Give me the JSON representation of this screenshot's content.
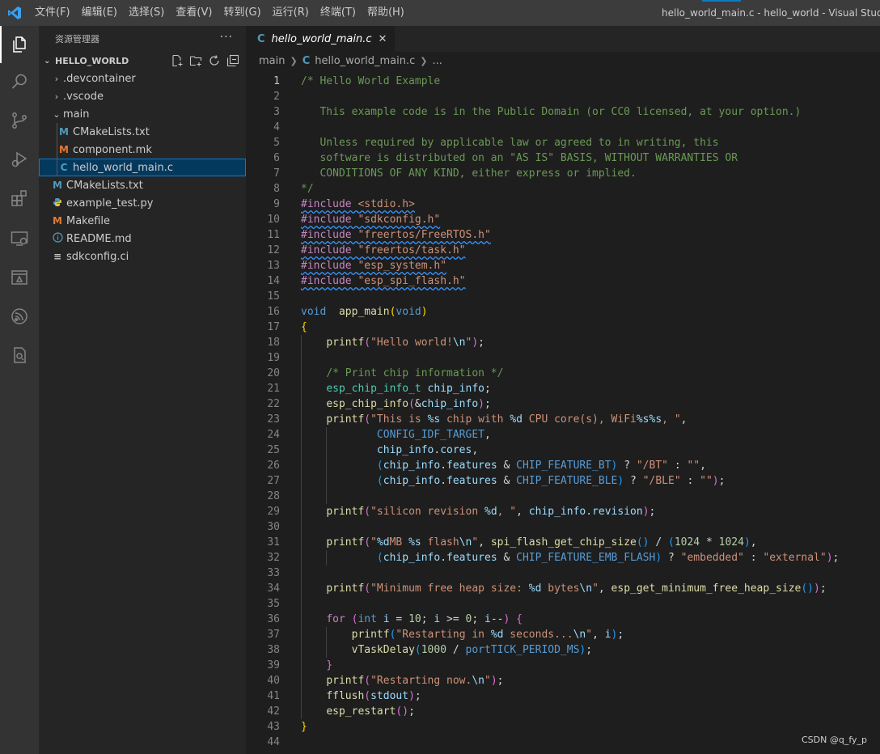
{
  "titlebar": {
    "menus": [
      "文件(F)",
      "编辑(E)",
      "选择(S)",
      "查看(V)",
      "转到(G)",
      "运行(R)",
      "终端(T)",
      "帮助(H)"
    ],
    "window_title": "hello_world_main.c - hello_world - Visual Studio Code",
    "accent_color": "#0e7ac4"
  },
  "activitybar": {
    "icons": [
      "explorer-icon",
      "search-icon",
      "source-control-icon",
      "run-debug-icon",
      "extensions-icon",
      "remote-explorer-icon",
      "deploy-icon",
      "espressif-icon",
      "test-icon"
    ]
  },
  "sidebar": {
    "title": "资源管理器",
    "more": "···",
    "section": "HELLO_WORLD",
    "tree": [
      {
        "label": ".devcontainer",
        "type": "folder",
        "expanded": false,
        "depth": 1
      },
      {
        "label": ".vscode",
        "type": "folder",
        "expanded": false,
        "depth": 1
      },
      {
        "label": "main",
        "type": "folder",
        "expanded": true,
        "depth": 1
      },
      {
        "label": "CMakeLists.txt",
        "type": "cmake",
        "depth": 2,
        "icon": "M"
      },
      {
        "label": "component.mk",
        "type": "make",
        "depth": 2,
        "icon": "M"
      },
      {
        "label": "hello_world_main.c",
        "type": "c",
        "depth": 2,
        "icon": "C",
        "selected": true
      },
      {
        "label": "CMakeLists.txt",
        "type": "cmake",
        "depth": 1,
        "icon": "M"
      },
      {
        "label": "example_test.py",
        "type": "python",
        "depth": 1,
        "icon": "py"
      },
      {
        "label": "Makefile",
        "type": "make",
        "depth": 1,
        "icon": "M"
      },
      {
        "label": "README.md",
        "type": "info",
        "depth": 1,
        "icon": "i"
      },
      {
        "label": "sdkconfig.ci",
        "type": "text",
        "depth": 1,
        "icon": "≡"
      }
    ]
  },
  "editor": {
    "tab_label": "hello_world_main.c",
    "tab_icon": "C",
    "close": "✕",
    "breadcrumb": {
      "folder": "main",
      "file": "hello_world_main.c",
      "more": "..."
    }
  },
  "code": {
    "current_line": 1,
    "lines": [
      [
        [
          "cmt",
          "/* Hello World Example"
        ]
      ],
      [],
      [
        [
          "cmt",
          "   This example code is in the Public Domain (or CC0 licensed, at your option.)"
        ]
      ],
      [],
      [
        [
          "cmt",
          "   Unless required by applicable law or agreed to in writing, this"
        ]
      ],
      [
        [
          "cmt",
          "   software is distributed on an \"AS IS\" BASIS, WITHOUT WARRANTIES OR"
        ]
      ],
      [
        [
          "cmt",
          "   CONDITIONS OF ANY KIND, either express or implied."
        ]
      ],
      [
        [
          "cmt",
          "*/"
        ]
      ],
      [
        [
          "pp squig",
          "#include "
        ],
        [
          "str squig",
          "<stdio.h>"
        ]
      ],
      [
        [
          "pp squig",
          "#include "
        ],
        [
          "str squig",
          "\"sdkconfig.h\""
        ]
      ],
      [
        [
          "pp squig",
          "#include "
        ],
        [
          "str squig",
          "\"freertos/FreeRTOS.h\""
        ]
      ],
      [
        [
          "pp squig",
          "#include "
        ],
        [
          "str squig",
          "\"freertos/task.h\""
        ]
      ],
      [
        [
          "pp squig",
          "#include "
        ],
        [
          "str squig",
          "\"esp_system.h\""
        ]
      ],
      [
        [
          "pp squig",
          "#include "
        ],
        [
          "str squig",
          "\"esp_spi_flash.h\""
        ]
      ],
      [],
      [
        [
          "kw",
          "void"
        ],
        [
          "",
          "  "
        ],
        [
          "fn",
          "app_main"
        ],
        [
          "brk",
          "("
        ],
        [
          "kw",
          "void"
        ],
        [
          "brk",
          ")"
        ]
      ],
      [
        [
          "brk",
          "{"
        ]
      ],
      [
        [
          "",
          "    "
        ],
        [
          "fn",
          "printf"
        ],
        [
          "brk2",
          "("
        ],
        [
          "str",
          "\"Hello world!"
        ],
        [
          "fmt",
          "\\n"
        ],
        [
          "str",
          "\""
        ],
        [
          "brk2",
          ")"
        ],
        [
          "",
          ";"
        ]
      ],
      [],
      [
        [
          "",
          "    "
        ],
        [
          "cmt",
          "/* Print chip information */"
        ]
      ],
      [
        [
          "",
          "    "
        ],
        [
          "typ",
          "esp_chip_info_t"
        ],
        [
          "",
          " "
        ],
        [
          "var",
          "chip_info"
        ],
        [
          "",
          ";"
        ]
      ],
      [
        [
          "",
          "    "
        ],
        [
          "fn",
          "esp_chip_info"
        ],
        [
          "brk2",
          "("
        ],
        [
          "",
          "&"
        ],
        [
          "var",
          "chip_info"
        ],
        [
          "brk2",
          ")"
        ],
        [
          "",
          ";"
        ]
      ],
      [
        [
          "",
          "    "
        ],
        [
          "fn",
          "printf"
        ],
        [
          "brk2",
          "("
        ],
        [
          "str",
          "\"This is "
        ],
        [
          "fmt",
          "%s"
        ],
        [
          "str",
          " chip with "
        ],
        [
          "fmt",
          "%d"
        ],
        [
          "str",
          " CPU core(s), WiFi"
        ],
        [
          "fmt",
          "%s%s"
        ],
        [
          "str",
          ", \""
        ],
        [
          "",
          ","
        ]
      ],
      [
        [
          "",
          "            "
        ],
        [
          "mac",
          "CONFIG_IDF_TARGET"
        ],
        [
          "",
          ","
        ]
      ],
      [
        [
          "",
          "            "
        ],
        [
          "var",
          "chip_info"
        ],
        [
          "",
          "."
        ],
        [
          "var",
          "cores"
        ],
        [
          "",
          ","
        ]
      ],
      [
        [
          "",
          "            "
        ],
        [
          "brk3",
          "("
        ],
        [
          "var",
          "chip_info"
        ],
        [
          "",
          "."
        ],
        [
          "var",
          "features"
        ],
        [
          "",
          " & "
        ],
        [
          "mac",
          "CHIP_FEATURE_BT"
        ],
        [
          "brk3",
          ")"
        ],
        [
          "",
          " ? "
        ],
        [
          "str",
          "\"/BT\""
        ],
        [
          "",
          " : "
        ],
        [
          "str",
          "\"\""
        ],
        [
          "",
          ","
        ]
      ],
      [
        [
          "",
          "            "
        ],
        [
          "brk3",
          "("
        ],
        [
          "var",
          "chip_info"
        ],
        [
          "",
          "."
        ],
        [
          "var",
          "features"
        ],
        [
          "",
          " & "
        ],
        [
          "mac",
          "CHIP_FEATURE_BLE"
        ],
        [
          "brk3",
          ")"
        ],
        [
          "",
          " ? "
        ],
        [
          "str",
          "\"/BLE\""
        ],
        [
          "",
          " : "
        ],
        [
          "str",
          "\"\""
        ],
        [
          "brk2",
          ")"
        ],
        [
          "",
          ";"
        ]
      ],
      [],
      [
        [
          "",
          "    "
        ],
        [
          "fn",
          "printf"
        ],
        [
          "brk2",
          "("
        ],
        [
          "str",
          "\"silicon revision "
        ],
        [
          "fmt",
          "%d"
        ],
        [
          "str",
          ", \""
        ],
        [
          "",
          ", "
        ],
        [
          "var",
          "chip_info"
        ],
        [
          "",
          "."
        ],
        [
          "var",
          "revision"
        ],
        [
          "brk2",
          ")"
        ],
        [
          "",
          ";"
        ]
      ],
      [],
      [
        [
          "",
          "    "
        ],
        [
          "fn",
          "printf"
        ],
        [
          "brk2",
          "("
        ],
        [
          "str",
          "\""
        ],
        [
          "fmt",
          "%d"
        ],
        [
          "str",
          "MB "
        ],
        [
          "fmt",
          "%s"
        ],
        [
          "str",
          " flash"
        ],
        [
          "fmt",
          "\\n"
        ],
        [
          "str",
          "\""
        ],
        [
          "",
          ", "
        ],
        [
          "fn",
          "spi_flash_get_chip_size"
        ],
        [
          "brk3",
          "()"
        ],
        [
          "",
          " / "
        ],
        [
          "brk3",
          "("
        ],
        [
          "num",
          "1024"
        ],
        [
          "",
          " * "
        ],
        [
          "num",
          "1024"
        ],
        [
          "brk3",
          ")"
        ],
        [
          "",
          ","
        ]
      ],
      [
        [
          "",
          "            "
        ],
        [
          "brk3",
          "("
        ],
        [
          "var",
          "chip_info"
        ],
        [
          "",
          "."
        ],
        [
          "var",
          "features"
        ],
        [
          "",
          " & "
        ],
        [
          "mac",
          "CHIP_FEATURE_EMB_FLASH"
        ],
        [
          "brk3",
          ")"
        ],
        [
          "",
          " ? "
        ],
        [
          "str",
          "\"embedded\""
        ],
        [
          "",
          " : "
        ],
        [
          "str",
          "\"external\""
        ],
        [
          "brk2",
          ")"
        ],
        [
          "",
          ";"
        ]
      ],
      [],
      [
        [
          "",
          "    "
        ],
        [
          "fn",
          "printf"
        ],
        [
          "brk2",
          "("
        ],
        [
          "str",
          "\"Minimum free heap size: "
        ],
        [
          "fmt",
          "%d"
        ],
        [
          "str",
          " bytes"
        ],
        [
          "fmt",
          "\\n"
        ],
        [
          "str",
          "\""
        ],
        [
          "",
          ", "
        ],
        [
          "fn",
          "esp_get_minimum_free_heap_size"
        ],
        [
          "brk3",
          "()"
        ],
        [
          "brk2",
          ")"
        ],
        [
          "",
          ";"
        ]
      ],
      [],
      [
        [
          "",
          "    "
        ],
        [
          "pp",
          "for"
        ],
        [
          "",
          " "
        ],
        [
          "brk2",
          "("
        ],
        [
          "kw",
          "int"
        ],
        [
          "",
          " "
        ],
        [
          "var",
          "i"
        ],
        [
          "",
          " = "
        ],
        [
          "num",
          "10"
        ],
        [
          "",
          "; "
        ],
        [
          "var",
          "i"
        ],
        [
          "",
          " >= "
        ],
        [
          "num",
          "0"
        ],
        [
          "",
          "; "
        ],
        [
          "var",
          "i"
        ],
        [
          "",
          "--"
        ],
        [
          "brk2",
          ")"
        ],
        [
          "",
          " "
        ],
        [
          "brk2",
          "{"
        ]
      ],
      [
        [
          "",
          "        "
        ],
        [
          "fn",
          "printf"
        ],
        [
          "brk3",
          "("
        ],
        [
          "str",
          "\"Restarting in "
        ],
        [
          "fmt",
          "%d"
        ],
        [
          "str",
          " seconds..."
        ],
        [
          "fmt",
          "\\n"
        ],
        [
          "str",
          "\""
        ],
        [
          "",
          ", "
        ],
        [
          "var",
          "i"
        ],
        [
          "brk3",
          ")"
        ],
        [
          "",
          ";"
        ]
      ],
      [
        [
          "",
          "        "
        ],
        [
          "fn",
          "vTaskDelay"
        ],
        [
          "brk3",
          "("
        ],
        [
          "num",
          "1000"
        ],
        [
          "",
          " / "
        ],
        [
          "mac",
          "portTICK_PERIOD_MS"
        ],
        [
          "brk3",
          ")"
        ],
        [
          "",
          ";"
        ]
      ],
      [
        [
          "",
          "    "
        ],
        [
          "brk2",
          "}"
        ]
      ],
      [
        [
          "",
          "    "
        ],
        [
          "fn",
          "printf"
        ],
        [
          "brk2",
          "("
        ],
        [
          "str",
          "\"Restarting now."
        ],
        [
          "fmt",
          "\\n"
        ],
        [
          "str",
          "\""
        ],
        [
          "brk2",
          ")"
        ],
        [
          "",
          ";"
        ]
      ],
      [
        [
          "",
          "    "
        ],
        [
          "fn",
          "fflush"
        ],
        [
          "brk2",
          "("
        ],
        [
          "var",
          "stdout"
        ],
        [
          "brk2",
          ")"
        ],
        [
          "",
          ";"
        ]
      ],
      [
        [
          "",
          "    "
        ],
        [
          "fn",
          "esp_restart"
        ],
        [
          "brk2",
          "()"
        ],
        [
          "",
          ";"
        ]
      ],
      [
        [
          "brk",
          "}"
        ]
      ],
      []
    ]
  },
  "watermark": "CSDN @q_fy_p"
}
